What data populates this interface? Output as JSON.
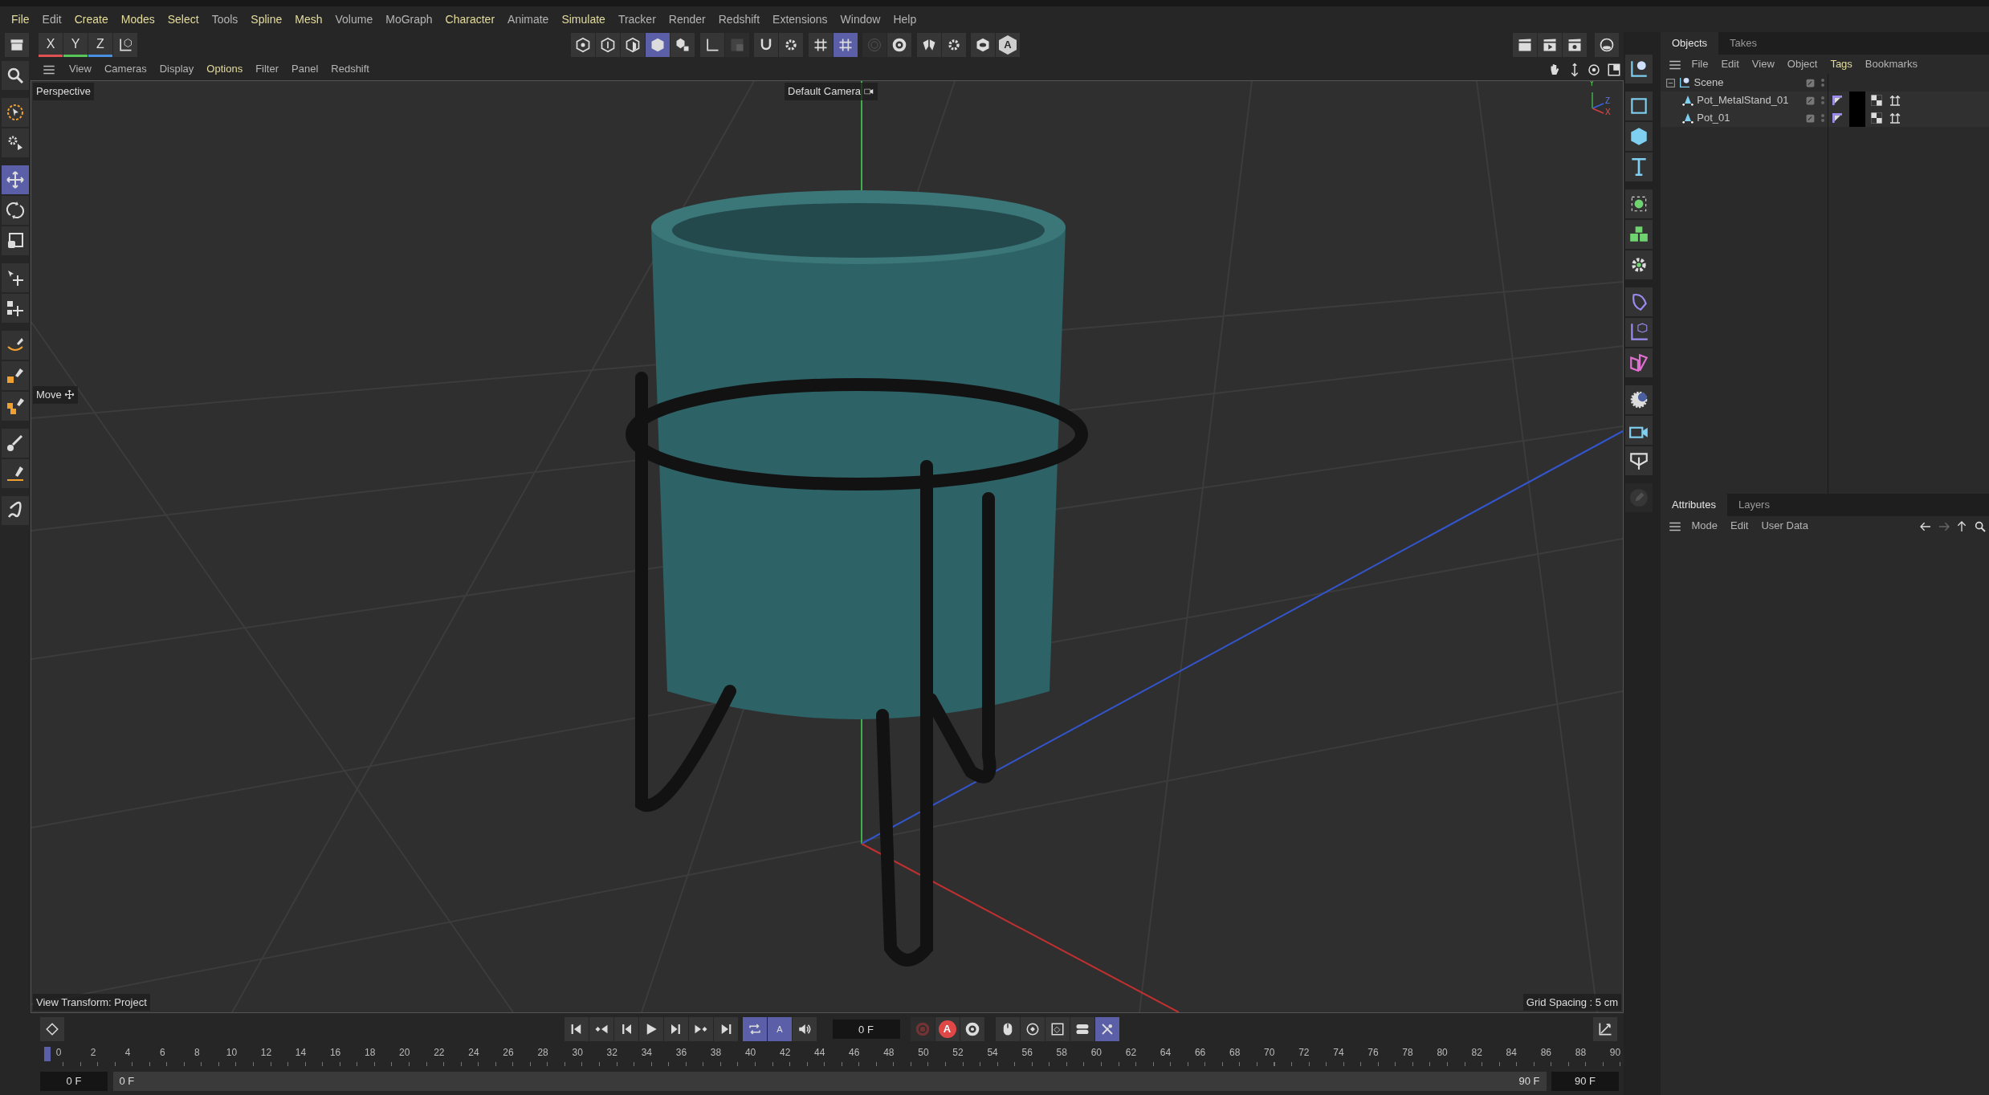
{
  "menu_bar": [
    {
      "label": "File",
      "color": "#e4dc9c"
    },
    {
      "label": "Edit",
      "color": "#b4b4b4"
    },
    {
      "label": "Create",
      "color": "#e4dc9c"
    },
    {
      "label": "Modes",
      "color": "#e4dc9c"
    },
    {
      "label": "Select",
      "color": "#e4dc9c"
    },
    {
      "label": "Tools",
      "color": "#b4b4b4"
    },
    {
      "label": "Spline",
      "color": "#e4dc9c"
    },
    {
      "label": "Mesh",
      "color": "#e4dc9c"
    },
    {
      "label": "Volume",
      "color": "#b4b4b4"
    },
    {
      "label": "MoGraph",
      "color": "#b4b4b4"
    },
    {
      "label": "Character",
      "color": "#e4dc9c"
    },
    {
      "label": "Animate",
      "color": "#b4b4b4"
    },
    {
      "label": "Simulate",
      "color": "#e4dc9c"
    },
    {
      "label": "Tracker",
      "color": "#b4b4b4"
    },
    {
      "label": "Render",
      "color": "#b4b4b4"
    },
    {
      "label": "Redshift",
      "color": "#b4b4b4"
    },
    {
      "label": "Extensions",
      "color": "#b4b4b4"
    },
    {
      "label": "Window",
      "color": "#b4b4b4"
    },
    {
      "label": "Help",
      "color": "#b4b4b4"
    }
  ],
  "main_toolbar": {
    "left": [
      {
        "selected": false
      },
      {
        "label": "X",
        "color": "#e05252",
        "selected": false
      },
      {
        "label": "Y",
        "color": "#58c558",
        "selected": false
      },
      {
        "label": "Z",
        "color": "#4a90e2",
        "selected": false
      },
      {
        "selected": false
      }
    ],
    "center": [
      {
        "selected": false,
        "disabled": false
      },
      {
        "selected": false,
        "disabled": false
      },
      {
        "selected": false,
        "disabled": false
      },
      {
        "selected": true,
        "disabled": false
      },
      {
        "selected": false,
        "disabled": false
      },
      {
        "selected": false,
        "disabled": false
      },
      {
        "selected": false,
        "disabled": true
      },
      {
        "selected": false,
        "disabled": false
      },
      {
        "selected": false,
        "disabled": false
      },
      {
        "selected": false,
        "disabled": false
      },
      {
        "selected": true,
        "disabled": false
      },
      {
        "selected": false,
        "disabled": true
      },
      {
        "selected": false,
        "disabled": false
      },
      {
        "selected": false,
        "disabled": false
      },
      {
        "selected": false,
        "disabled": false
      },
      {
        "selected": false,
        "disabled": false
      },
      {
        "label": "A",
        "selected": false,
        "disabled": false
      }
    ],
    "right": [
      {
        "selected": false
      },
      {
        "selected": false
      },
      {
        "selected": false
      },
      {
        "selected": false
      }
    ]
  },
  "tool_palette": [
    {
      "selected": false
    },
    {
      "selected": false
    },
    {
      "selected": false
    },
    {
      "selected": true
    },
    {
      "selected": false
    },
    {
      "selected": false
    },
    {
      "selected": false
    },
    {
      "selected": false
    },
    {
      "selected": false
    },
    {
      "selected": false
    },
    {
      "selected": false
    },
    {
      "selected": false
    },
    {
      "selected": false
    },
    {
      "selected": false
    }
  ],
  "viewport": {
    "menu": [
      {
        "label": "View",
        "color": "#b4b4b4"
      },
      {
        "label": "Cameras",
        "color": "#b4b4b4"
      },
      {
        "label": "Display",
        "color": "#b4b4b4"
      },
      {
        "label": "Options",
        "color": "#e4dc9c"
      },
      {
        "label": "Filter",
        "color": "#b4b4b4"
      },
      {
        "label": "Panel",
        "color": "#b4b4b4"
      },
      {
        "label": "Redshift",
        "color": "#b4b4b4"
      }
    ],
    "name": "Perspective",
    "camera": "Default Camera",
    "tool_hint": "Move",
    "axis_labels": [
      "Y",
      "Z",
      "X"
    ],
    "view_transform": "View Transform: Project",
    "grid_spacing": "Grid Spacing : 5 cm"
  },
  "object_palette": [
    {
      "disabled": false
    },
    {
      "disabled": false
    },
    {
      "disabled": false
    },
    {
      "disabled": false
    },
    {
      "disabled": false
    },
    {
      "disabled": false
    },
    {
      "disabled": false
    },
    {
      "disabled": false
    },
    {
      "disabled": false
    },
    {
      "disabled": false
    },
    {
      "disabled": false
    },
    {
      "disabled": false
    },
    {
      "disabled": false
    },
    {
      "disabled": true
    }
  ],
  "objects_panel": {
    "tabs": [
      {
        "label": "Objects",
        "selected": true
      },
      {
        "label": "Takes",
        "selected": false
      }
    ],
    "menu": [
      {
        "label": "File",
        "color": "#b4b4b4"
      },
      {
        "label": "Edit",
        "color": "#b4b4b4"
      },
      {
        "label": "View",
        "color": "#b4b4b4"
      },
      {
        "label": "Object",
        "color": "#b4b4b4"
      },
      {
        "label": "Tags",
        "color": "#e4dc9c"
      },
      {
        "label": "Bookmarks",
        "color": "#b4b4b4"
      }
    ],
    "tree": [
      {
        "name": "Scene",
        "expanded": true,
        "children": [
          {
            "name": "Pot_MetalStand_01"
          },
          {
            "name": "Pot_01"
          }
        ]
      }
    ]
  },
  "attributes_panel": {
    "tabs": [
      {
        "label": "Attributes",
        "selected": true
      },
      {
        "label": "Layers",
        "selected": false
      }
    ],
    "menu": [
      "Mode",
      "Edit",
      "User Data"
    ]
  },
  "timeline": {
    "transport": [
      {
        "selected": false
      },
      {
        "selected": false
      },
      {
        "selected": false
      },
      {
        "selected": false
      },
      {
        "selected": false
      },
      {
        "selected": false
      },
      {
        "selected": false
      }
    ],
    "playback": [
      {
        "selected": true
      },
      {
        "label": "A",
        "selected": true
      },
      {
        "selected": false
      }
    ],
    "current_frame": "0 F",
    "record": [
      {
        "disabled": true
      },
      {
        "label": "A",
        "disabled": false
      },
      {
        "disabled": false
      }
    ],
    "keys": [
      {
        "selected": false
      },
      {
        "selected": false
      },
      {
        "selected": false
      },
      {
        "selected": false
      },
      {
        "selected": true
      }
    ],
    "ticks": [
      "0",
      "2",
      "4",
      "6",
      "8",
      "10",
      "12",
      "14",
      "16",
      "18",
      "20",
      "22",
      "24",
      "26",
      "28",
      "30",
      "32",
      "34",
      "36",
      "38",
      "40",
      "42",
      "44",
      "46",
      "48",
      "50",
      "52",
      "54",
      "56",
      "58",
      "60",
      "62",
      "64",
      "66",
      "68",
      "70",
      "72",
      "74",
      "76",
      "78",
      "80",
      "82",
      "84",
      "86",
      "88",
      "90"
    ],
    "playhead": {
      "level": 0
    },
    "range_start": "0 F",
    "range_from": "0 F",
    "range_to": "90 F",
    "range_end": "90 F"
  }
}
